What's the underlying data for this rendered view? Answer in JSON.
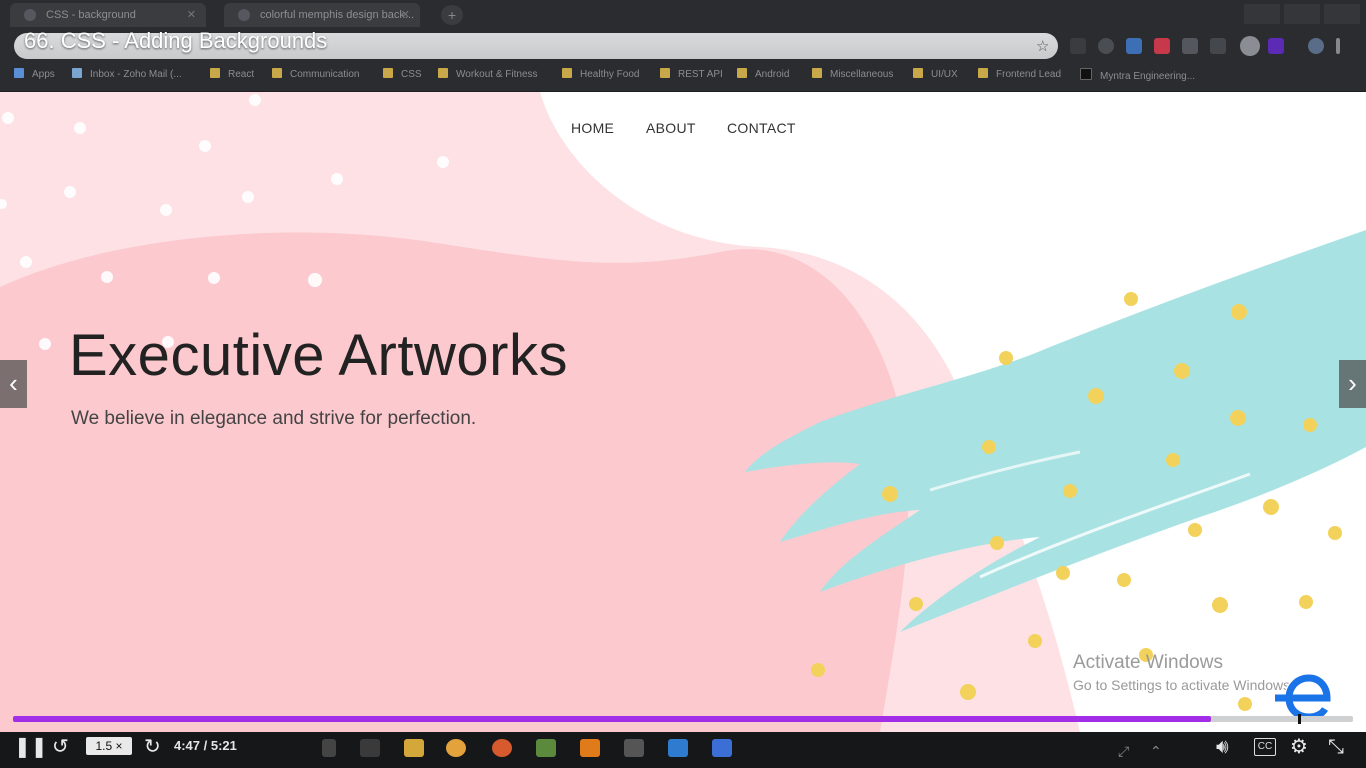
{
  "browser": {
    "tabs": [
      {
        "label": "CSS - background"
      },
      {
        "label": "colorful memphis design back..."
      }
    ],
    "video_title": "66. CSS - Adding Backgrounds",
    "bookmarks": [
      {
        "label": "Apps"
      },
      {
        "label": "Inbox - Zoho Mail (..."
      },
      {
        "label": "React"
      },
      {
        "label": "Communication"
      },
      {
        "label": "CSS"
      },
      {
        "label": "Workout & Fitness"
      },
      {
        "label": "Healthy Food"
      },
      {
        "label": "REST API"
      },
      {
        "label": "Android"
      },
      {
        "label": "Miscellaneous"
      },
      {
        "label": "UI/UX"
      },
      {
        "label": "Frontend Lead"
      },
      {
        "label": "Myntra Engineering..."
      }
    ]
  },
  "site": {
    "nav": [
      {
        "label": "HOME"
      },
      {
        "label": "ABOUT"
      },
      {
        "label": "CONTACT"
      }
    ],
    "headline": "Executive Artworks",
    "tagline": "We believe in elegance and strive for perfection."
  },
  "overlay": {
    "prev_icon": "‹",
    "next_icon": "›",
    "activation_title": "Activate Windows",
    "activation_text": "Go to Settings to activate Windows."
  },
  "player": {
    "speed": "1.5 ×",
    "time": "4:47 / 5:21",
    "progress": 0.894,
    "cc_label": "CC",
    "accent_color": "#a22ee8"
  },
  "colors": {
    "pink": "#fbc9ce",
    "light_pink": "#fde3e6",
    "teal": "#a9e2e3",
    "yellow": "#f2d25b"
  }
}
